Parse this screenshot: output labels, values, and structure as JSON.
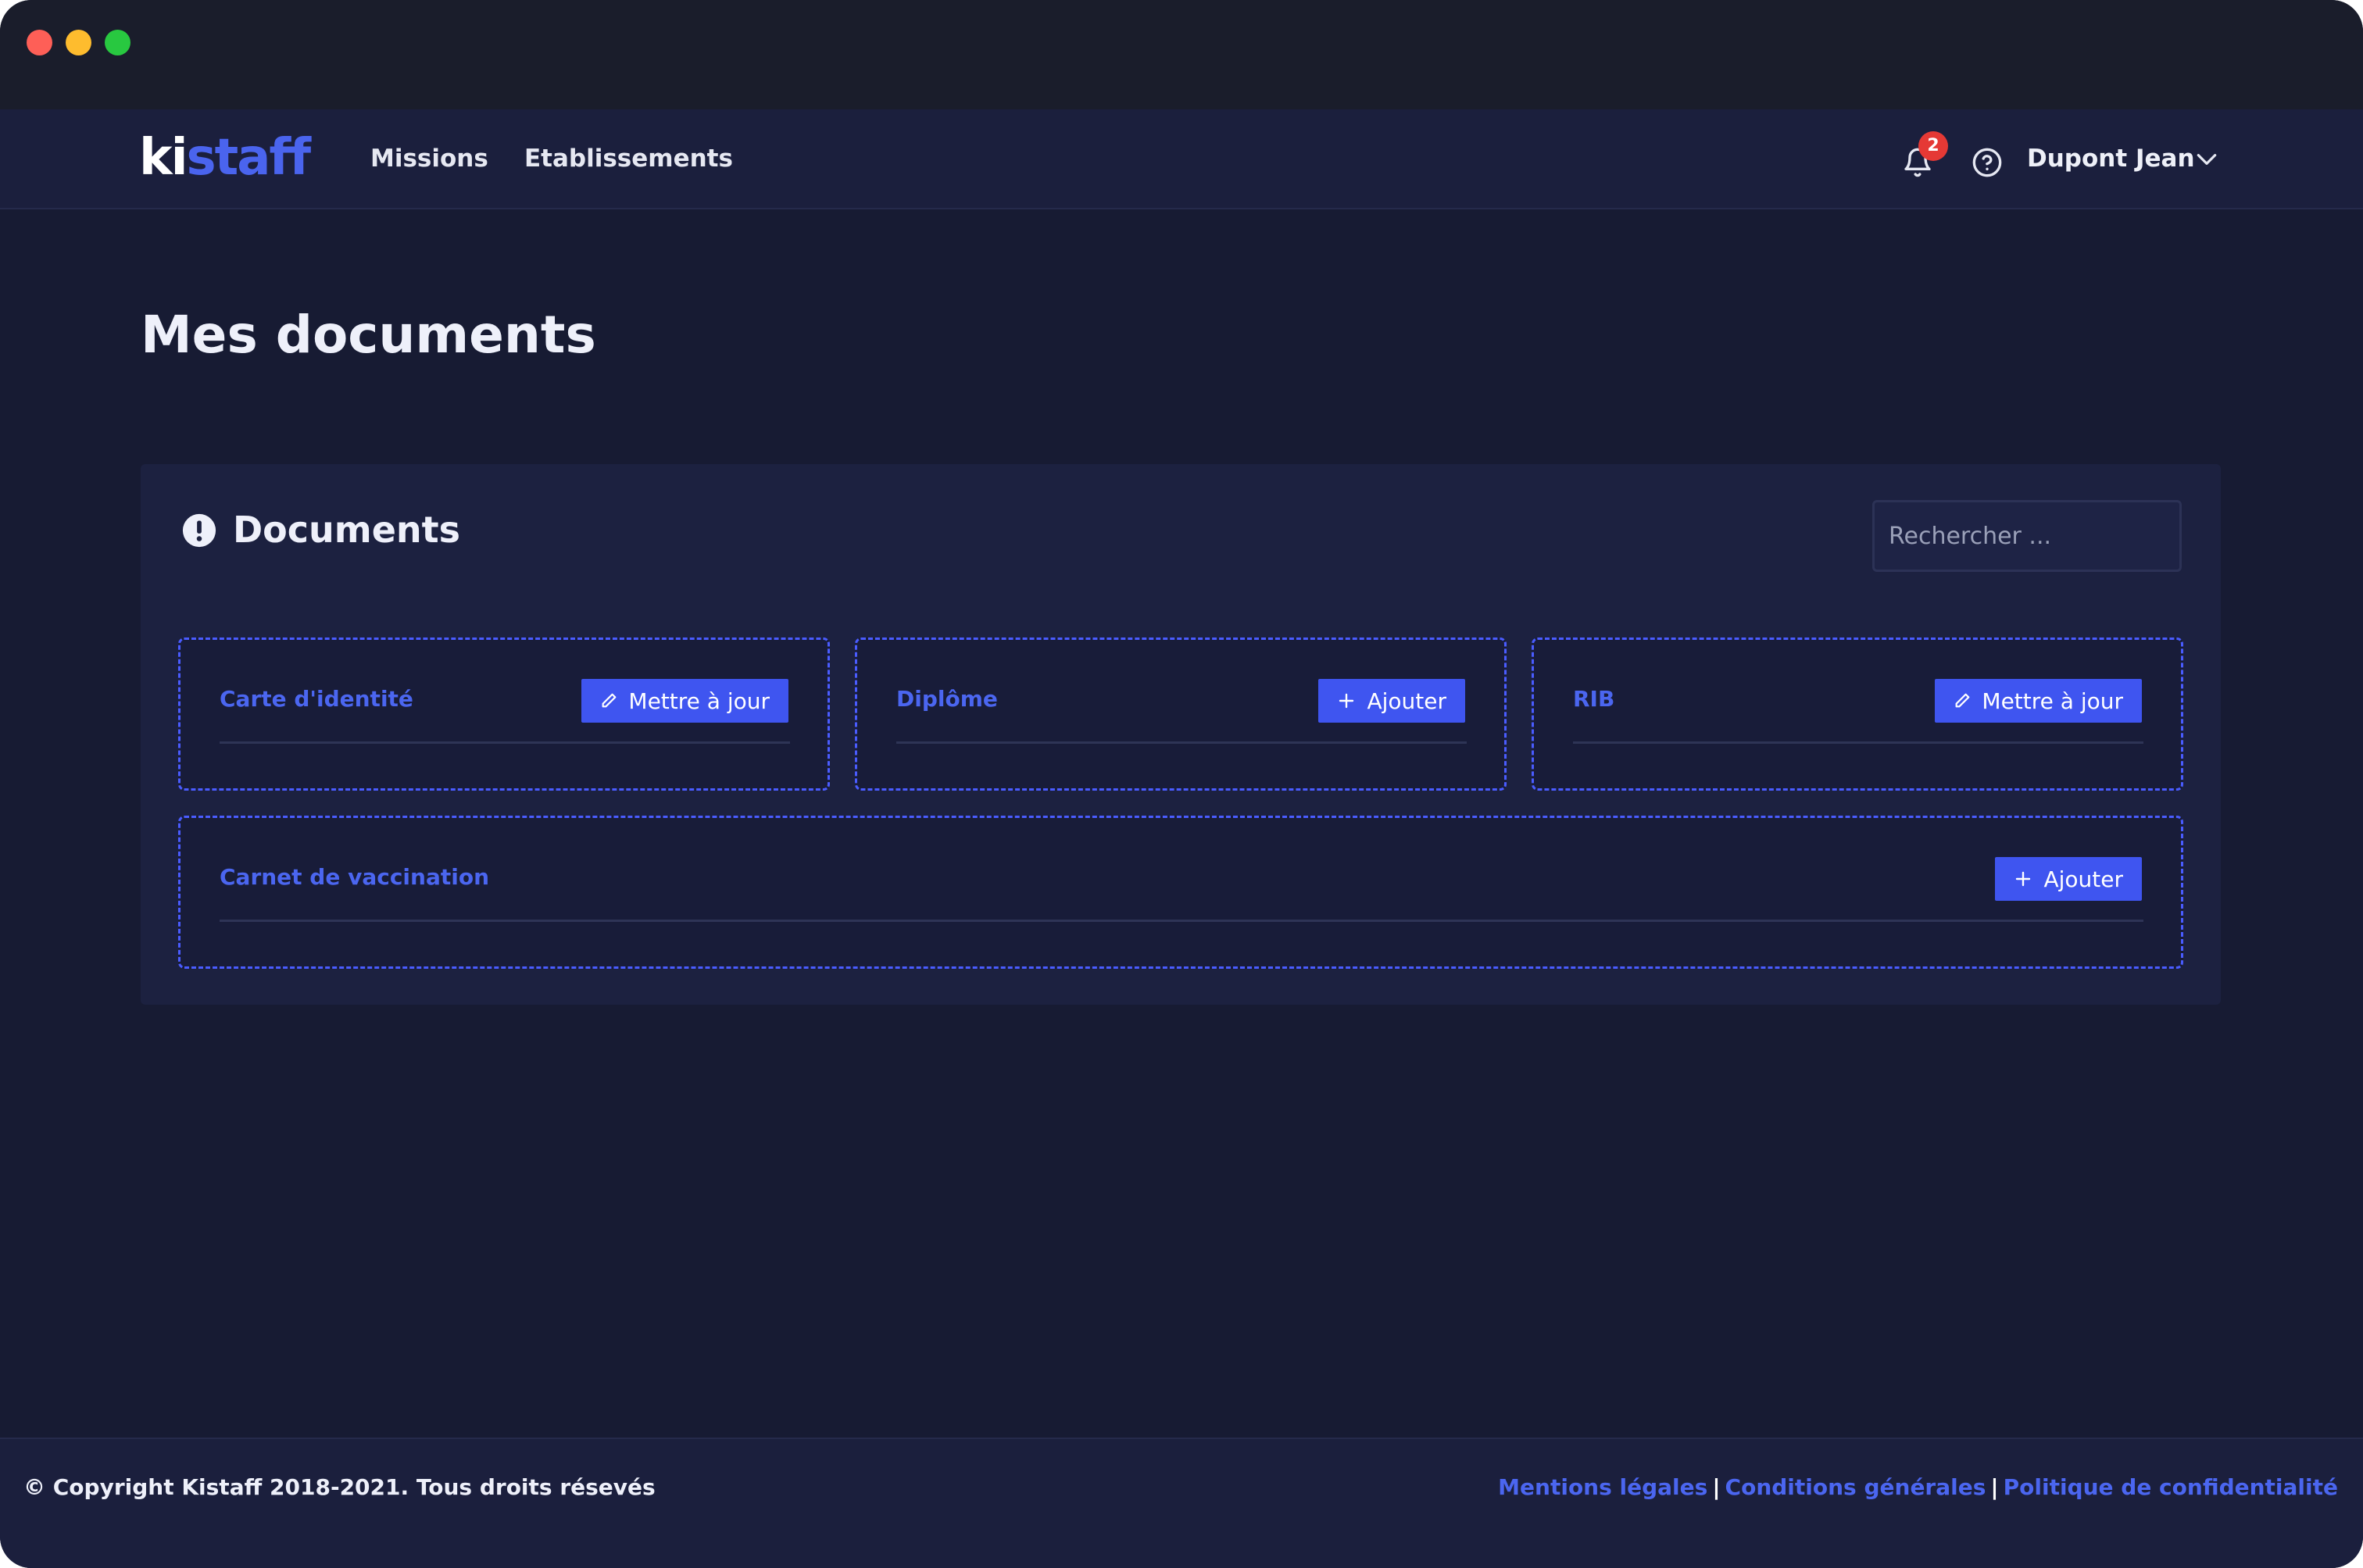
{
  "brand": {
    "logo_part1": "ki",
    "logo_part2": "staff"
  },
  "nav": {
    "missions": "Missions",
    "etablissements": "Etablissements"
  },
  "header": {
    "notification_count": "2",
    "user_name": "Dupont Jean"
  },
  "page": {
    "title": "Mes documents"
  },
  "panel": {
    "title": "Documents",
    "search_placeholder": "Rechercher ...",
    "documents": [
      {
        "label": "Carte d'identité",
        "action": "Mettre à jour",
        "action_icon": "pencil-icon"
      },
      {
        "label": "Diplôme",
        "action": "Ajouter",
        "action_icon": "plus-icon"
      },
      {
        "label": "RIB",
        "action": "Mettre à jour",
        "action_icon": "pencil-icon"
      },
      {
        "label": "Carnet de vaccination",
        "action": "Ajouter",
        "action_icon": "plus-icon"
      }
    ]
  },
  "footer": {
    "copyright": "© Copyright Kistaff 2018-2021. Tous droits résevés",
    "links": [
      "Mentions légales",
      "Conditions générales",
      "Politique de confidentialité"
    ],
    "separator": "|"
  },
  "colors": {
    "accent": "#3f55f0",
    "background": "#171b33",
    "navbar": "#1b1f3d",
    "badge": "#e53935"
  }
}
